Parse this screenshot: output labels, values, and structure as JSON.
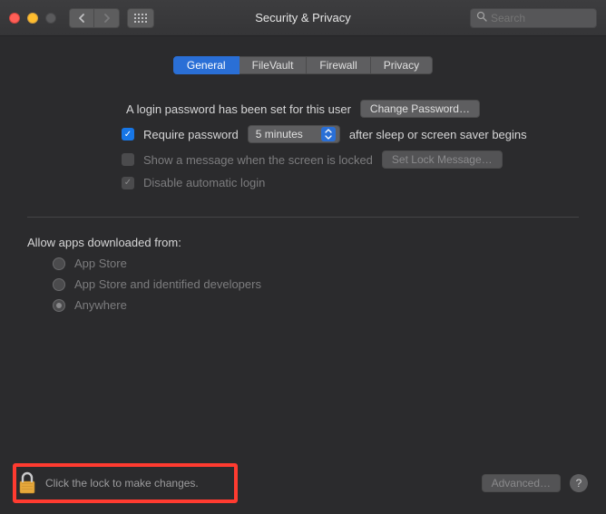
{
  "window": {
    "title": "Security & Privacy"
  },
  "search": {
    "placeholder": "Search"
  },
  "tabs": [
    "General",
    "FileVault",
    "Firewall",
    "Privacy"
  ],
  "login": {
    "text": "A login password has been set for this user",
    "change_btn": "Change Password…",
    "require_label": "Require password",
    "delay_value": "5 minutes",
    "after_label": "after sleep or screen saver begins",
    "show_msg_label": "Show a message when the screen is locked",
    "set_lock_btn": "Set Lock Message…",
    "disable_auto_label": "Disable automatic login"
  },
  "gatekeeper": {
    "heading": "Allow apps downloaded from:",
    "options": [
      "App Store",
      "App Store and identified developers",
      "Anywhere"
    ]
  },
  "footer": {
    "lock_text": "Click the lock to make changes.",
    "advanced_btn": "Advanced…"
  }
}
